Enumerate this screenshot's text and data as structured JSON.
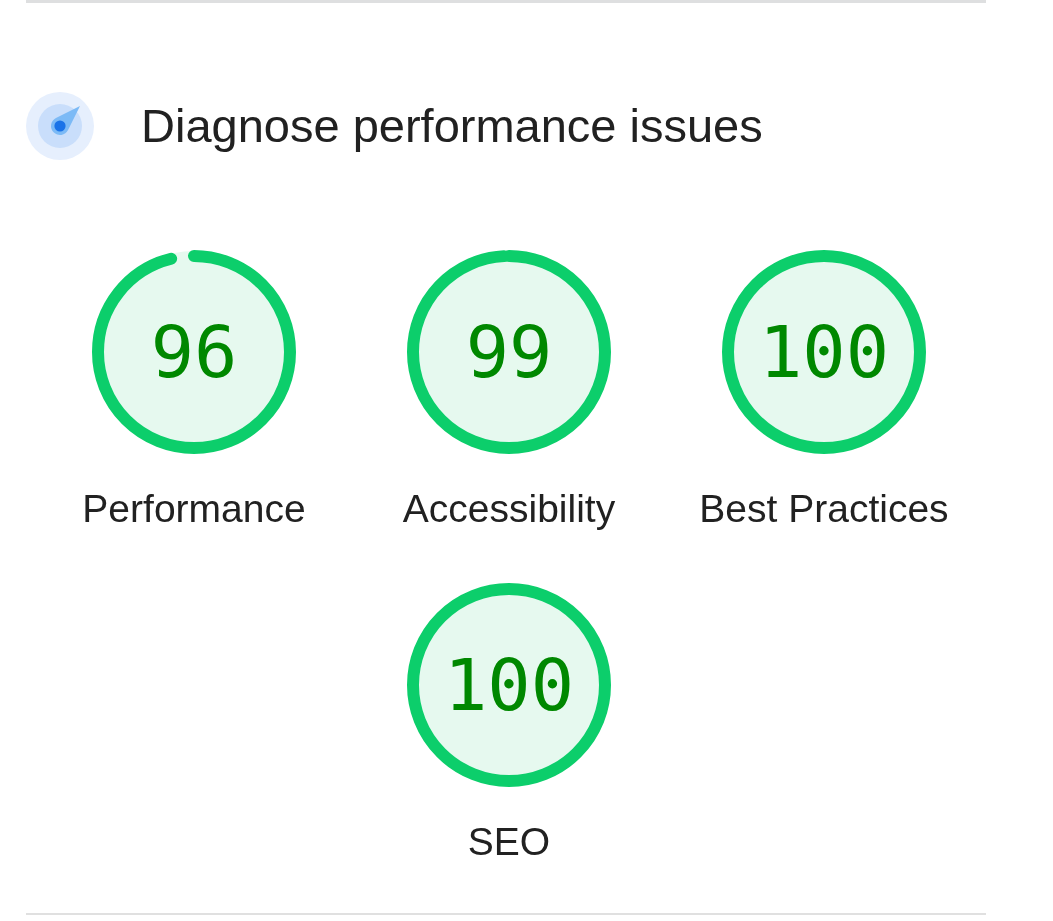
{
  "section": {
    "title": "Diagnose performance issues"
  },
  "gauges": [
    {
      "score": "96",
      "label": "Performance",
      "level": 0.96
    },
    {
      "score": "99",
      "label": "Accessibility",
      "level": 0.99
    },
    {
      "score": "100",
      "label": "Best Practices",
      "level": 1
    },
    {
      "score": "100",
      "label": "SEO",
      "level": 1
    }
  ]
}
